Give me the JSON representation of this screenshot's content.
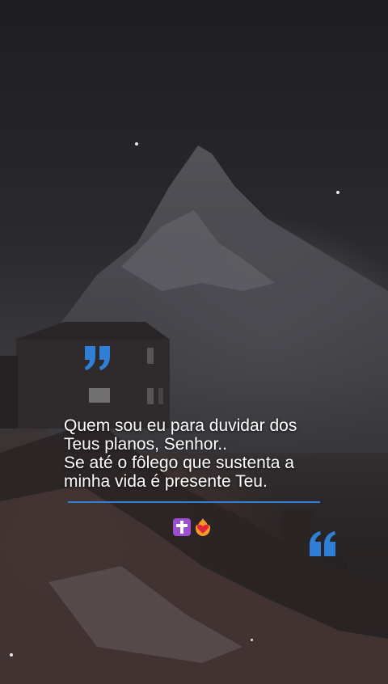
{
  "quote": {
    "lines": [
      "Quem sou eu para duvidar dos",
      "Teus planos, Senhor..",
      "Se até o fôlego que sustenta a",
      "minha vida é presente Teu."
    ]
  },
  "icons": {
    "open_quote": "open-quote-icon",
    "close_quote": "close-quote-icon",
    "cross": "latin-cross-icon",
    "heart": "heart-on-fire-icon"
  },
  "colors": {
    "accent": "#2f7fd6",
    "text": "#ffffff"
  }
}
